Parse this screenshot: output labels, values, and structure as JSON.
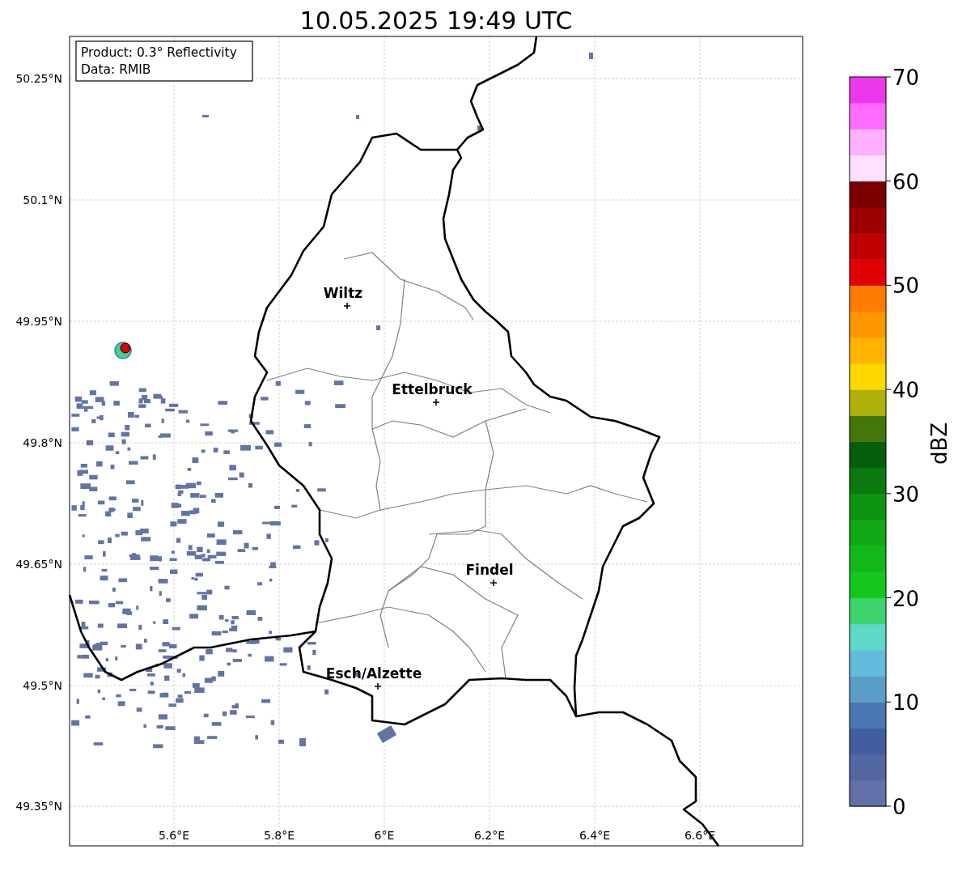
{
  "title": "10.05.2025 19:49 UTC",
  "legend": {
    "lines": [
      "Product: 0.3° Reflectivity",
      "Data: RMIB"
    ]
  },
  "map": {
    "xticks": [
      "5.6°E",
      "5.8°E",
      "6°E",
      "6.2°E",
      "6.4°E",
      "6.6°E"
    ],
    "yticks": [
      "50.25°N",
      "50.1°N",
      "49.95°N",
      "49.8°N",
      "49.65°N",
      "49.5°N",
      "49.35°N"
    ],
    "cities": [
      {
        "name": "Wiltz"
      },
      {
        "name": "Ettelbruck"
      },
      {
        "name": "Findel"
      },
      {
        "name": "Esch/Alzette"
      }
    ]
  },
  "colorbar": {
    "label": "dBZ",
    "ticks": [
      "70",
      "60",
      "50",
      "40",
      "30",
      "20",
      "10",
      "0"
    ],
    "bands": [
      {
        "color": "#6272a8"
      },
      {
        "color": "#5367a2"
      },
      {
        "color": "#425ea2"
      },
      {
        "color": "#4a78b2"
      },
      {
        "color": "#5a9ec8"
      },
      {
        "color": "#62bcdc"
      },
      {
        "color": "#5fd8c8"
      },
      {
        "color": "#3dd46e"
      },
      {
        "color": "#13c81c"
      },
      {
        "color": "#12b81a"
      },
      {
        "color": "#10a814"
      },
      {
        "color": "#0d9412"
      },
      {
        "color": "#0a7a10"
      },
      {
        "color": "#065e0c"
      },
      {
        "color": "#45760c"
      },
      {
        "color": "#b0b00a"
      },
      {
        "color": "#ffd800"
      },
      {
        "color": "#ffb400"
      },
      {
        "color": "#ff9800"
      },
      {
        "color": "#ff7c00"
      },
      {
        "color": "#e00000"
      },
      {
        "color": "#c00000"
      },
      {
        "color": "#9c0000"
      },
      {
        "color": "#7a0000"
      },
      {
        "color": "#ffe0ff"
      },
      {
        "color": "#ffb0ff"
      },
      {
        "color": "#ff6cff"
      },
      {
        "color": "#ea38ea"
      }
    ]
  }
}
